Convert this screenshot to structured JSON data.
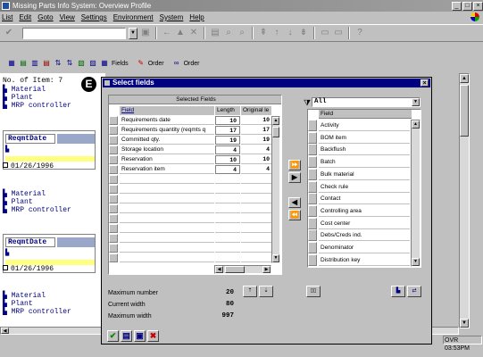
{
  "window": {
    "title": "Missing Parts Info System: Overview Profile",
    "min": "_",
    "max": "□",
    "close": "×"
  },
  "menu": [
    "List",
    "Edit",
    "Goto",
    "View",
    "Settings",
    "Environment",
    "System",
    "Help"
  ],
  "toolbar2": {
    "fields_label": "Fields",
    "order_label": "Order",
    "order2_label": "Order"
  },
  "left": {
    "line1": "No. of Item: 7",
    "labels": [
      "Material",
      "Plant",
      "MRP controller"
    ],
    "col_header": "ReqmtDate",
    "date": "01/26/1996"
  },
  "badge": "E",
  "dialog": {
    "title": "Select fields",
    "selected_header": "Selected Fields",
    "col_field": "Field",
    "col_length": "Length",
    "col_original": "Original le",
    "rows": [
      {
        "field": "Requirements date",
        "length": "10",
        "original": "10"
      },
      {
        "field": "Requirements quantity (reqmts q",
        "length": "17",
        "original": "17"
      },
      {
        "field": "Committed qty.",
        "length": "19",
        "original": "19"
      },
      {
        "field": "Storage location",
        "length": "4",
        "original": "4"
      },
      {
        "field": "Reservation",
        "length": "10",
        "original": "10"
      },
      {
        "field": "Reservation item",
        "length": "4",
        "original": "4"
      }
    ],
    "filter_value": "All",
    "avail_header": "Field",
    "avail_rows": [
      "Activity",
      "BOM item",
      "Backflush",
      "Batch",
      "Bulk material",
      "Check rule",
      "Contact",
      "Controlling area",
      "Cost center",
      "Debs/Creds ind.",
      "Denominator",
      "Distribution key"
    ],
    "max_number_label": "Maximum number",
    "max_number": "20",
    "current_width_label": "Current width",
    "current_width": "80",
    "max_width_label": "Maximum width",
    "max_width": "997"
  },
  "status": {
    "mode": "OVR",
    "time": "03:53PM"
  }
}
